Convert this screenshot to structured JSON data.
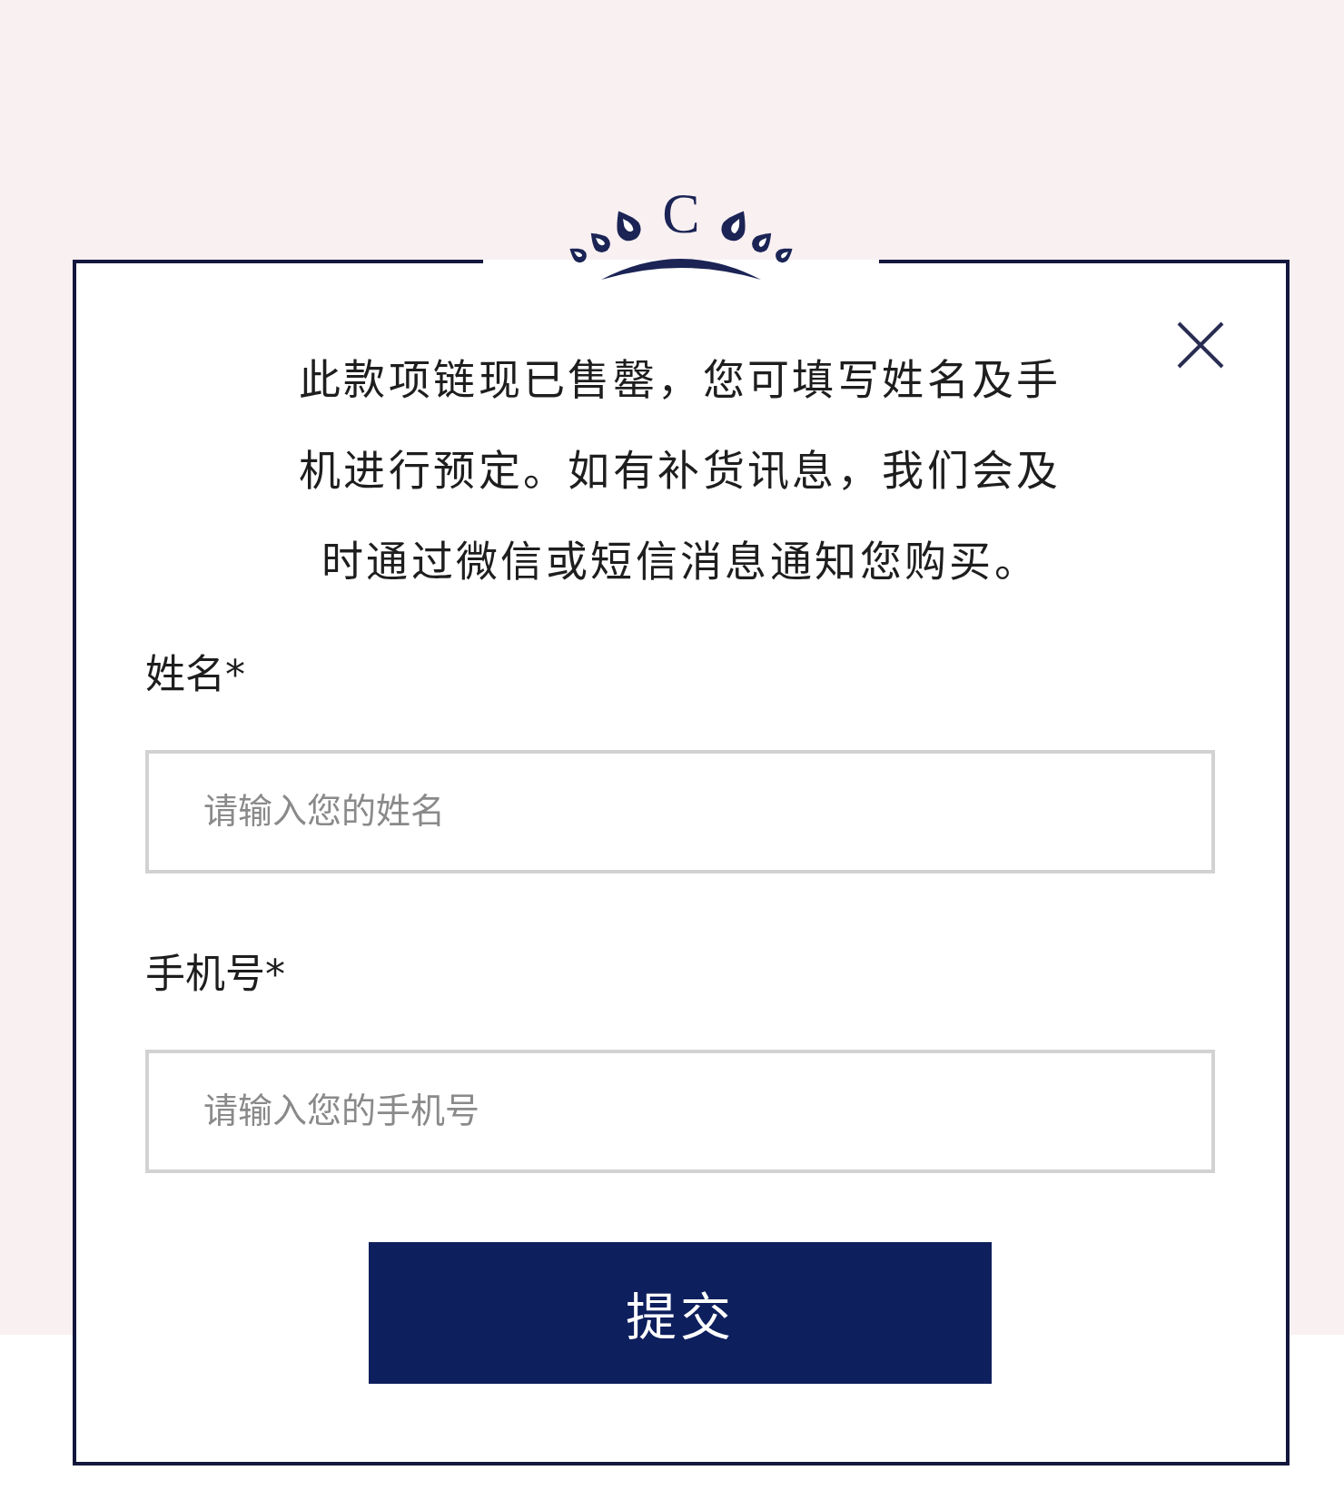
{
  "logo": {
    "letter": "C"
  },
  "message": "此款项链现已售罄，您可填写姓名及手机进行预定。如有补货讯息，我们会及时通过微信或短信消息通知您购买。",
  "fields": [
    {
      "label": "姓名*",
      "placeholder": "请输入您的姓名"
    },
    {
      "label": "手机号*",
      "placeholder": "请输入您的手机号"
    }
  ],
  "submit_button": {
    "label": "提交"
  }
}
